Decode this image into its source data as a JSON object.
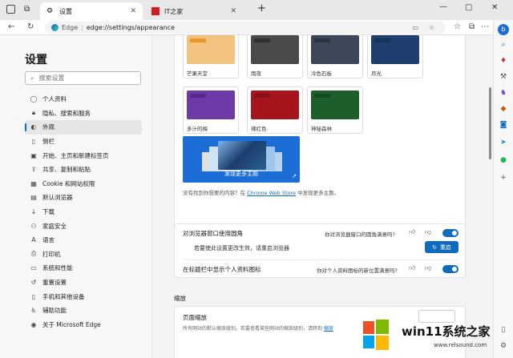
{
  "browser": {
    "tabs": [
      {
        "label": "设置",
        "active": true
      },
      {
        "label": "IT之家",
        "active": false
      }
    ],
    "new_tab": "+",
    "address": {
      "site_label": "Edge",
      "url": "edge://settings/appearance"
    }
  },
  "sidebar": {
    "title": "设置",
    "search_placeholder": "搜索设置",
    "items": [
      {
        "label": "个人资料",
        "icon": "person-icon"
      },
      {
        "label": "隐私、搜索和服务",
        "icon": "lock-icon"
      },
      {
        "label": "外观",
        "icon": "palette-icon",
        "selected": true
      },
      {
        "label": "侧栏",
        "icon": "sidebar-icon"
      },
      {
        "label": "开始、主页和新建标签页",
        "icon": "home-icon"
      },
      {
        "label": "共享、复制和粘贴",
        "icon": "share-icon"
      },
      {
        "label": "Cookie 和网站权限",
        "icon": "cookie-icon"
      },
      {
        "label": "默认浏览器",
        "icon": "browser-icon"
      },
      {
        "label": "下载",
        "icon": "download-icon"
      },
      {
        "label": "家庭安全",
        "icon": "family-icon"
      },
      {
        "label": "语言",
        "icon": "language-icon"
      },
      {
        "label": "打印机",
        "icon": "printer-icon"
      },
      {
        "label": "系统和性能",
        "icon": "system-icon"
      },
      {
        "label": "重置设置",
        "icon": "reset-icon"
      },
      {
        "label": "手机和其他设备",
        "icon": "phone-icon"
      },
      {
        "label": "辅助功能",
        "icon": "accessibility-icon"
      },
      {
        "label": "关于 Microsoft Edge",
        "icon": "edge-icon"
      }
    ]
  },
  "themes": {
    "items": [
      {
        "label": "芒果天堂",
        "color": "#f2c27f",
        "accent": "#e8962a"
      },
      {
        "label": "雨夜",
        "color": "#4a4a4a",
        "accent": "#2f2f2f"
      },
      {
        "label": "冷色石板",
        "color": "#3e4757",
        "accent": "#2b3340"
      },
      {
        "label": "月光",
        "color": "#1f3f6e",
        "accent": "#173259"
      },
      {
        "label": "多汁的梅",
        "color": "#6d3aa8",
        "accent": "#57298e"
      },
      {
        "label": "辣红色",
        "color": "#a8141c",
        "accent": "#8a0f16"
      },
      {
        "label": "神秘森林",
        "color": "#1e5e2a",
        "accent": "#164a20"
      }
    ],
    "more_label": "发现更多主题",
    "note_prefix": "没有找到你想要的内容？在",
    "note_link": "Chrome Web Store",
    "note_suffix": "中发现更多主题。"
  },
  "settings": {
    "rounded": {
      "label": "对浏览器窗口使用圆角",
      "question": "你对浏览器窗口的圆角满意吗?",
      "enabled": true
    },
    "restart": {
      "note": "若要使此设置更改生效，请重启浏览器",
      "button": "重启"
    },
    "profile_icon": {
      "label": "在标题栏中显示个人资料图标",
      "question": "你对个人资料图标的新位置满意吗?",
      "enabled": true
    }
  },
  "zoom": {
    "section": "缩放",
    "title": "页面缩放",
    "desc": "所有网站的默认缩放级别。若要查看某些网站的缩放级别，请转到",
    "desc_link": "缩放"
  },
  "watermark": {
    "brand": "win11系统之家",
    "url": "www.relsound.com"
  },
  "colors": {
    "accent": "#0f6cbd"
  }
}
